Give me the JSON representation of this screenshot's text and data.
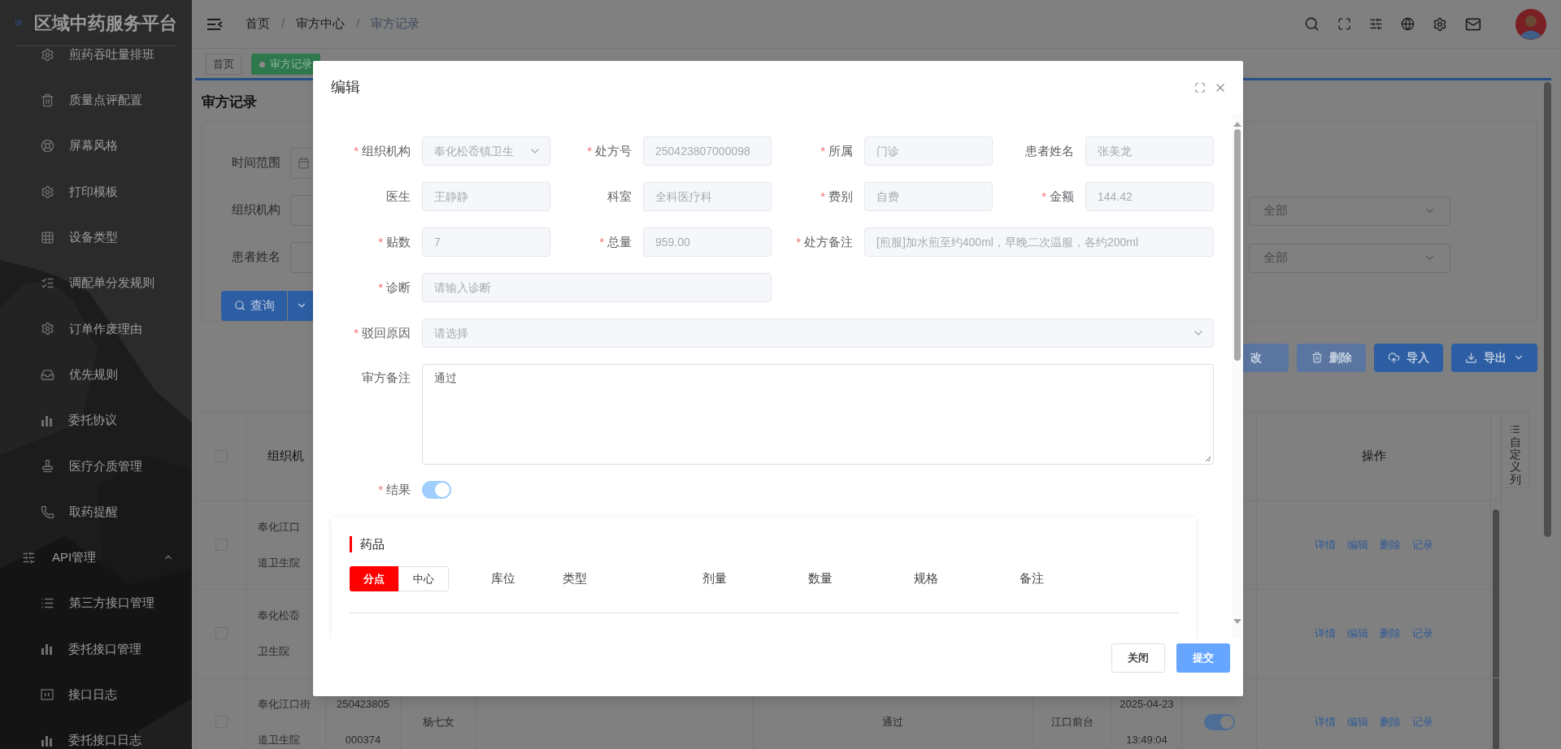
{
  "sidebar": {
    "title": "区域中药服务平台",
    "items": [
      {
        "label": "煎药吞吐量排班"
      },
      {
        "label": "质量点评配置"
      },
      {
        "label": "屏幕风格"
      },
      {
        "label": "打印模板"
      },
      {
        "label": "设备类型"
      },
      {
        "label": "调配单分发规则"
      },
      {
        "label": "订单作废理由"
      },
      {
        "label": "优先规则"
      },
      {
        "label": "委托协议"
      },
      {
        "label": "医疗介质管理"
      },
      {
        "label": "取药提醒"
      }
    ],
    "groups": [
      {
        "label": "API管理",
        "expanded": true,
        "children": [
          {
            "label": "第三方接口管理"
          },
          {
            "label": "委托接口管理"
          },
          {
            "label": "接口日志"
          },
          {
            "label": "委托接口日志"
          }
        ]
      }
    ]
  },
  "breadcrumb": [
    "首页",
    "审方中心",
    "审方记录"
  ],
  "breadcrumb_separator": "/",
  "tags": [
    {
      "label": "首页",
      "selected": false
    },
    {
      "label": "审方记录",
      "selected": true
    }
  ],
  "page_title": "审方记录",
  "filters": [
    {
      "label": "时间范围"
    },
    {
      "label": "组织机构"
    },
    {
      "label": "患者姓名"
    }
  ],
  "right_filters": [
    {
      "value": "全部"
    },
    {
      "value": "全部"
    }
  ],
  "query_button": "查询",
  "toolbar": [
    {
      "label": "改",
      "kind": "edit",
      "disabled": true
    },
    {
      "label": "删除",
      "kind": "delete",
      "disabled": true
    },
    {
      "label": "导入",
      "kind": "import",
      "disabled": false
    },
    {
      "label": "导出",
      "kind": "export",
      "disabled": false
    }
  ],
  "table": {
    "columns": [
      "组织机",
      "操作"
    ],
    "select_all_checked": false,
    "side_tab": "自定义列",
    "rows": [
      {
        "checked": false,
        "column_2": [
          "奉化江口",
          "道卫生院"
        ],
        "actions": [
          "详情",
          "编辑",
          "删除",
          "记录"
        ]
      },
      {
        "checked": false,
        "column_2": [
          "奉化松岙",
          "卫生院"
        ],
        "actions": [
          "详情",
          "编辑",
          "删除",
          "记录"
        ]
      },
      {
        "checked": false,
        "column_2": [
          "奉化江口街",
          "道卫生院"
        ],
        "column_3": [
          "250423805",
          "000374"
        ],
        "column_4": [
          "杨七女"
        ],
        "column_6": [
          "通过"
        ],
        "column_7": [
          "江口前台"
        ],
        "column_8": [
          "2025-04-23",
          "13:49:04"
        ],
        "switch_on": true,
        "actions": [
          "详情",
          "编辑",
          "删除",
          "记录"
        ]
      }
    ]
  },
  "modal": {
    "title": "编辑",
    "required_mark": "*",
    "fields": [
      {
        "kind": "select",
        "label": "组织机构",
        "required": true,
        "disabled": true,
        "value": "奉化松岙镇卫生"
      },
      {
        "kind": "input",
        "label": "处方号",
        "required": true,
        "disabled": true,
        "value": "250423807000098"
      },
      {
        "kind": "input",
        "label": "所属",
        "required": true,
        "disabled": true,
        "value": "门诊"
      },
      {
        "kind": "input",
        "label": "患者姓名",
        "required": false,
        "disabled": true,
        "value": "张美龙"
      },
      {
        "kind": "input",
        "label": "医生",
        "required": false,
        "disabled": true,
        "value": "王静静"
      },
      {
        "kind": "input",
        "label": "科室",
        "required": false,
        "disabled": true,
        "value": "全科医疗科"
      },
      {
        "kind": "input",
        "label": "费别",
        "required": true,
        "disabled": true,
        "value": "自费"
      },
      {
        "kind": "input",
        "label": "金额",
        "required": true,
        "disabled": true,
        "value": "144.42"
      },
      {
        "kind": "input",
        "label": "贴数",
        "required": true,
        "disabled": true,
        "value": "7"
      },
      {
        "kind": "input",
        "label": "总量",
        "required": true,
        "disabled": true,
        "value": "959.00"
      },
      {
        "kind": "input",
        "label": "处方备注",
        "required": true,
        "disabled": true,
        "value": "[煎服]加水煎至约400ml，早晚二次温服，各约200ml"
      },
      {
        "kind": "input",
        "label": "诊断",
        "required": true,
        "disabled": true,
        "placeholder": "请输入诊断"
      },
      {
        "kind": "select",
        "label": "驳回原因",
        "required": true,
        "disabled": true,
        "placeholder": "请选择"
      },
      {
        "kind": "textarea",
        "label": "审方备注",
        "required": false,
        "disabled": false,
        "value": "通过"
      },
      {
        "kind": "switch",
        "label": "结果",
        "required": true,
        "disabled": true,
        "on": true
      }
    ],
    "drug_section": {
      "title": "药品",
      "segments": [
        {
          "label": "分点",
          "selected": true
        },
        {
          "label": "中心",
          "selected": false
        }
      ],
      "columns": [
        "库位",
        "类型",
        "剂量",
        "数量",
        "规格",
        "备注"
      ]
    },
    "buttons": [
      {
        "label": "关闭",
        "kind": "default"
      },
      {
        "label": "提交",
        "kind": "primary"
      }
    ]
  }
}
